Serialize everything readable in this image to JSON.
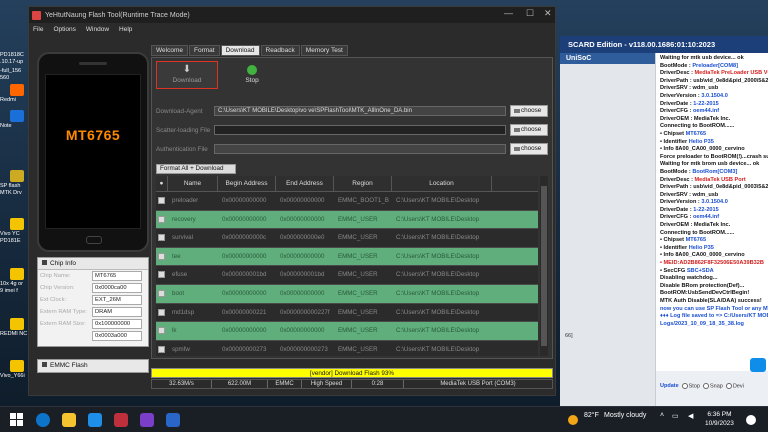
{
  "desktop": {
    "icons": [
      {
        "label": "PD1818C",
        "sub": ".10.17-up",
        "color": "#888"
      },
      {
        "label": "-full_156",
        "sub": "560",
        "color": "#777"
      },
      {
        "label": "Redmi",
        "sub": "",
        "color": "#ff6600"
      },
      {
        "label": "Note",
        "sub": "",
        "color": "#1a70d8"
      },
      {
        "label": "SP flash",
        "sub": "MTK Drv",
        "color": "#ccaa22"
      },
      {
        "label": "Vivo YC",
        "sub": "PD181E",
        "color": "#f5c400"
      },
      {
        "label": "10x 4g or",
        "sub": "9 imei f",
        "color": "#f5c400"
      },
      {
        "label": "REDMI NC",
        "sub": "",
        "color": "#f5c400"
      },
      {
        "label": "Vivo_Y66i",
        "sub": "",
        "color": "#f5c400"
      }
    ]
  },
  "flash_tool": {
    "title": "YeHtutNaung Flash Tool(Runtime Trace Mode)",
    "menu": [
      "File",
      "Options",
      "Window",
      "Help"
    ],
    "phone_model": "MT6765",
    "tabs": [
      "Welcome",
      "Format",
      "Download",
      "Readback",
      "Memory Test"
    ],
    "active_tab": "Download",
    "download_label": "Download",
    "stop_label": "Stop",
    "download_agent_label": "Download-Agent",
    "download_agent_value": "C:\\Users\\KT MOBILE\\Desktop\\vo ve\\SPFlashTool\\MTK_AllInOne_DA.bin",
    "scatter_label": "Scatter-loading File",
    "scatter_value": "",
    "auth_label": "Authentication File",
    "auth_value": "",
    "choose_label": "choose",
    "format_all_label": "Format All + Download",
    "columns": [
      "",
      "Name",
      "Begin Address",
      "End Address",
      "Region",
      "Location"
    ],
    "rows": [
      {
        "name": "preloader",
        "begin": "0x00000000000",
        "end": "0x00000000000",
        "region": "EMMC_BOOT1_B",
        "location": "C:\\Users\\KT MOBILE\\Desktop",
        "green": false
      },
      {
        "name": "recovery",
        "begin": "0x00000000000",
        "end": "0x00000000000",
        "region": "EMMC_USER",
        "location": "C:\\Users\\KT MOBILE\\Desktop",
        "green": true
      },
      {
        "name": "survival",
        "begin": "0x0000000000c",
        "end": "0x000000000e0",
        "region": "EMMC_USER",
        "location": "C:\\Users\\KT MOBILE\\Desktop",
        "green": false
      },
      {
        "name": "tee",
        "begin": "0x00000000000",
        "end": "0x00000000000",
        "region": "EMMC_USER",
        "location": "C:\\Users\\KT MOBILE\\Desktop",
        "green": true
      },
      {
        "name": "efuse",
        "begin": "0x000000001bd",
        "end": "0x000000001bd",
        "region": "EMMC_USER",
        "location": "C:\\Users\\KT MOBILE\\Desktop",
        "green": false
      },
      {
        "name": "boot",
        "begin": "0x00000000000",
        "end": "0x00000000000",
        "region": "EMMC_USER",
        "location": "C:\\Users\\KT MOBILE\\Desktop",
        "green": true
      },
      {
        "name": "md1dsp",
        "begin": "0x00000000221",
        "end": "0x000000000227f",
        "region": "EMMC_USER",
        "location": "C:\\Users\\KT MOBILE\\Desktop",
        "green": false
      },
      {
        "name": "lk",
        "begin": "0x00000000000",
        "end": "0x00000000000",
        "region": "EMMC_USER",
        "location": "C:\\Users\\KT MOBILE\\Desktop",
        "green": true
      },
      {
        "name": "spmfw",
        "begin": "0x00000000273",
        "end": "0x000000000273",
        "region": "EMMC_USER",
        "location": "C:\\Users\\KT MOBILE\\Desktop",
        "green": false
      }
    ],
    "chip_info": {
      "title": "Chip Info",
      "fields": [
        {
          "label": "Chip Name:",
          "value": "MT6765"
        },
        {
          "label": "Chip Version:",
          "value": "0x0000ca00"
        },
        {
          "label": "Ext Clock:",
          "value": "EXT_26M"
        },
        {
          "label": "Extern RAM Type:",
          "value": "DRAM"
        },
        {
          "label": "Extern RAM Size:",
          "value": "0x100000000"
        },
        {
          "label": "",
          "value": "0x0003a000"
        }
      ]
    },
    "emmc_label": "EMMC Flash",
    "progress_text": "[vendor] Download Flash 93%",
    "progress": 93,
    "status": [
      "32.63M/s",
      "622.00M",
      "EMMC",
      "High Speed",
      "0:28",
      "MediaTek USB Port (COM3)"
    ]
  },
  "right_app": {
    "title": "SCARD Edition - v118.00.1686:01:10:2023",
    "side_header": "UniSoC",
    "side_label": "66]",
    "log": [
      [
        {
          "t": "Waiting for mtk usb device... ok",
          "c": "k"
        }
      ],
      [
        {
          "t": "BootMode : ",
          "c": "k"
        },
        {
          "t": "Preloader[COM8]",
          "c": "b"
        }
      ],
      [
        {
          "t": "DriverDesc : ",
          "c": "k"
        },
        {
          "t": "MediaTek PreLoader USB VCO",
          "c": "r"
        }
      ],
      [
        {
          "t": "DriverPath : usb\\vid_0e8d&pid_2000\\5&2",
          "c": "k"
        }
      ],
      [
        {
          "t": "DriverSRV : wdm_usb",
          "c": "k"
        }
      ],
      [
        {
          "t": "DriverVersion : ",
          "c": "k"
        },
        {
          "t": "3.0.1504.0",
          "c": "b"
        }
      ],
      [
        {
          "t": "DriverDate : ",
          "c": "k"
        },
        {
          "t": "1-22-2015",
          "c": "b"
        }
      ],
      [
        {
          "t": "DriverCFG : ",
          "c": "k"
        },
        {
          "t": "oem44.inf",
          "c": "b"
        }
      ],
      [
        {
          "t": "DriverOEM : MediaTek Inc.",
          "c": "k"
        }
      ],
      [
        {
          "t": "Connecting to BootROM......",
          "c": "k"
        }
      ],
      [
        {
          "t": "• Chipset ",
          "c": "k"
        },
        {
          "t": "MT6765",
          "c": "b"
        }
      ],
      [
        {
          "t": "• Identifier ",
          "c": "k"
        },
        {
          "t": "Helio P35",
          "c": "b"
        }
      ],
      [
        {
          "t": "• Info 8A00_CA00_0000_cervino",
          "c": "k"
        }
      ],
      [
        {
          "t": "Force preloader to BootROM(!)...crash suc",
          "c": "k"
        }
      ],
      [
        {
          "t": "Waiting for mtk brom usb device... ok",
          "c": "k"
        }
      ],
      [
        {
          "t": "BootMode : ",
          "c": "k"
        },
        {
          "t": "BootRom[COM3]",
          "c": "b"
        }
      ],
      [
        {
          "t": "DriverDesc : ",
          "c": "k"
        },
        {
          "t": "MediaTek USB Port",
          "c": "r"
        }
      ],
      [
        {
          "t": "DriverPath : usb\\vid_0e8d&pid_0003\\5&2",
          "c": "k"
        }
      ],
      [
        {
          "t": "DriverSRV : wdm_usb",
          "c": "k"
        }
      ],
      [
        {
          "t": "DriverVersion : ",
          "c": "k"
        },
        {
          "t": "3.0.1504.0",
          "c": "b"
        }
      ],
      [
        {
          "t": "DriverDate : ",
          "c": "k"
        },
        {
          "t": "1-22-2015",
          "c": "b"
        }
      ],
      [
        {
          "t": "DriverCFG : ",
          "c": "k"
        },
        {
          "t": "oem44.inf",
          "c": "b"
        }
      ],
      [
        {
          "t": "DriverOEM : MediaTek Inc.",
          "c": "k"
        }
      ],
      [
        {
          "t": "Connecting to BootROM......",
          "c": "k"
        }
      ],
      [
        {
          "t": "• Chipset ",
          "c": "k"
        },
        {
          "t": "MT6765",
          "c": "b"
        }
      ],
      [
        {
          "t": "• Identifier ",
          "c": "k"
        },
        {
          "t": "Helio P35",
          "c": "b"
        }
      ],
      [
        {
          "t": "• Info 8A00_CA00_0000_cervino",
          "c": "k"
        }
      ],
      [
        {
          "t": "• MEID:AD2B862F8F32506E50A39B32B",
          "c": "r"
        }
      ],
      [
        {
          "t": "• SecCFG ",
          "c": "k"
        },
        {
          "t": "SBC+SDA",
          "c": "b"
        }
      ],
      [
        {
          "t": "Disabling watchdog...",
          "c": "k"
        }
      ],
      [
        {
          "t": "Disable BRom protection(Def)...",
          "c": "k"
        }
      ],
      [
        {
          "t": "BootROM:UsbSendDevCtrlBegin!",
          "c": "k"
        }
      ],
      [
        {
          "t": "MTK Auth Disable(SLA/DAA) success!",
          "c": "k"
        }
      ],
      [
        {
          "t": "now you can use SP Flash Tool or any MTK",
          "c": "b"
        }
      ],
      [
        {
          "t": "♦♦♦ Log file saved to => C:/Users/KT MOB",
          "c": "b"
        }
      ],
      [
        {
          "t": "Logs/2023_10_09_18_35_38.log",
          "c": "b"
        }
      ]
    ],
    "bottom": {
      "update": "Update",
      "stop": "Stop",
      "snap": "Snap",
      "device": "Devi"
    }
  },
  "taskbar": {
    "weather_temp": "82°F",
    "weather_text": "Mostly cloudy",
    "time": "6:36 PM",
    "date": "10/9/2023"
  }
}
